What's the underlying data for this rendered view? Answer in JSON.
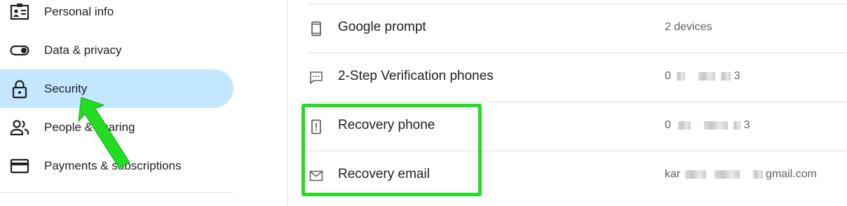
{
  "sidebar": {
    "items": [
      {
        "label": "Personal info",
        "icon": "id-card-icon"
      },
      {
        "label": "Data & privacy",
        "icon": "toggle-icon"
      },
      {
        "label": "Security",
        "icon": "lock-icon",
        "active": true
      },
      {
        "label": "People & sharing",
        "icon": "people-icon"
      },
      {
        "label": "Payments & subscriptions",
        "icon": "credit-card-icon"
      }
    ]
  },
  "security": {
    "rows": [
      {
        "label": "Google prompt",
        "value": "2 devices",
        "icon": "phone-icon"
      },
      {
        "label": "2-Step Verification phones",
        "value_prefix": "0",
        "value_suffix": "3",
        "icon": "message-icon"
      },
      {
        "label": "Recovery phone",
        "value_prefix": "0",
        "value_suffix": "3",
        "icon": "phone-alert-icon"
      },
      {
        "label": "Recovery email",
        "value_prefix": "kar",
        "value_suffix": "gmail.com",
        "icon": "mail-icon"
      }
    ]
  },
  "colors": {
    "active_background": "#c2e7ff",
    "highlight": "#22dd22",
    "arrow": "#22dd22"
  }
}
